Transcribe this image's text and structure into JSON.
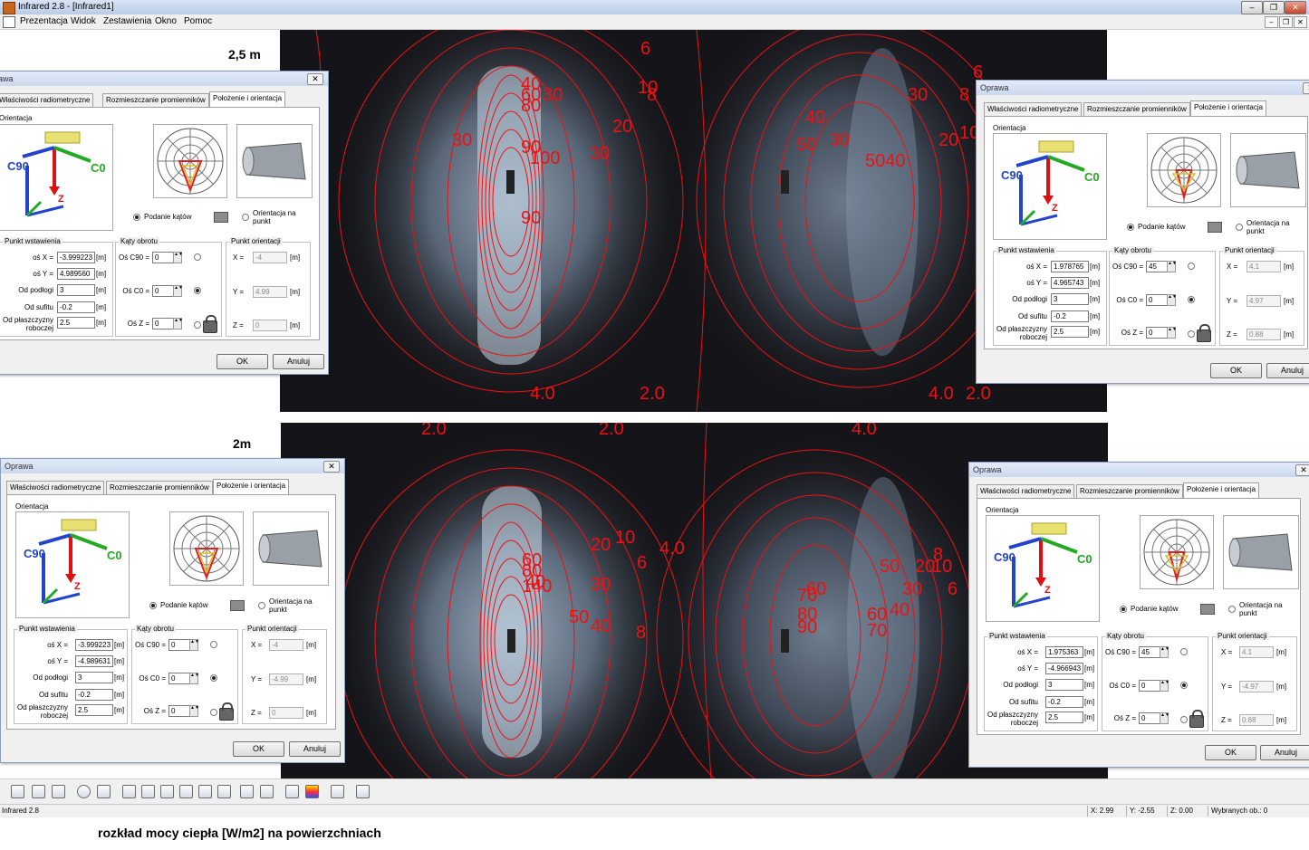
{
  "window": {
    "title": "Infrared 2.8 - [Infrared1]",
    "min_glyph": "–",
    "max_glyph": "❐",
    "close_glyph": "✕"
  },
  "menu": [
    "Prezentacja",
    "Widok",
    "Zestawienia",
    "Okno",
    "Pomoc"
  ],
  "heights": {
    "top": "2,5 m",
    "bottom": "2m"
  },
  "heatmap_top": {
    "labels": [
      "6",
      "6",
      "40",
      "60",
      "80",
      "30",
      "10",
      "8",
      "20",
      "30",
      "90",
      "100",
      "30",
      "90",
      "40",
      "50",
      "30",
      "30",
      "8",
      "20",
      "10",
      "5040",
      "4.0",
      "2.0",
      "4.0",
      "2.0"
    ]
  },
  "heatmap_bottom": {
    "labels": [
      "2.0",
      "2.0",
      "4.0",
      "20",
      "10",
      "4.0",
      "6",
      "60",
      "80",
      "40",
      "140",
      "30",
      "50",
      "40",
      "8",
      "50",
      "20",
      "10",
      "6",
      "8",
      "60",
      "70",
      "80",
      "90",
      "60",
      "40",
      "30",
      "70"
    ]
  },
  "dialogs": [
    {
      "title": "Oprawa",
      "tabs": [
        "Właściwości radiometryczne",
        "Rozmieszczanie promienników",
        "Położenie i orientacja"
      ],
      "orientation_title": "Orientacja",
      "axis_labels": {
        "c90": "C90",
        "c0": "C0",
        "z": "Z"
      },
      "radio_angles": "Podanie kątów",
      "radio_point": "Orientacja na punkt",
      "insert": {
        "title": "Punkt wstawienia",
        "x_label": "oś X =",
        "x": "-3.999223",
        "y_label": "oś Y =",
        "y": "4.989560",
        "floor_label": "Od podłogi",
        "floor": "3",
        "ceiling_label": "Od sufitu",
        "ceiling": "-0.2",
        "plane_label": "Od płaszczyzny roboczej",
        "plane": "2.5",
        "unit": "[m]"
      },
      "rotation": {
        "title": "Kąty obrotu",
        "c90_label": "Oś C90 =",
        "c90": "0",
        "c0_label": "Oś C0 =",
        "c0": "0",
        "z_label": "Oś Z =",
        "z": "0"
      },
      "orient_point": {
        "title": "Punkt orientacji",
        "x_label": "X =",
        "x": "-4",
        "y_label": "Y =",
        "y": "4.99",
        "z_label": "Z =",
        "z": "0",
        "unit": "[m]"
      },
      "ok": "OK",
      "cancel": "Anuluj"
    },
    {
      "title": "Oprawa",
      "tabs": [
        "Właściwości radiometryczne",
        "Rozmieszczanie promienników",
        "Położenie i orientacja"
      ],
      "orientation_title": "Orientacja",
      "axis_labels": {
        "c90": "C90",
        "c0": "C0",
        "z": "Z"
      },
      "radio_angles": "Podanie kątów",
      "radio_point": "Orientacja na punkt",
      "insert": {
        "title": "Punkt wstawienia",
        "x_label": "oś X =",
        "x": "1.978765",
        "y_label": "oś Y =",
        "y": "4.965743",
        "floor_label": "Od podłogi",
        "floor": "3",
        "ceiling_label": "Od sufitu",
        "ceiling": "-0.2",
        "plane_label": "Od płaszczyzny roboczej",
        "plane": "2.5",
        "unit": "[m]"
      },
      "rotation": {
        "title": "Kąty obrotu",
        "c90_label": "Oś C90 =",
        "c90": "45",
        "c0_label": "Oś C0 =",
        "c0": "0",
        "z_label": "Oś Z =",
        "z": "0"
      },
      "orient_point": {
        "title": "Punkt orientacji",
        "x_label": "X =",
        "x": "4.1",
        "y_label": "Y =",
        "y": "4.97",
        "z_label": "Z =",
        "z": "0.88",
        "unit": "[m]"
      },
      "ok": "OK",
      "cancel": "Anuluj"
    },
    {
      "title": "Oprawa",
      "tabs": [
        "Właściwości radiometryczne",
        "Rozmieszczanie promienników",
        "Położenie i orientacja"
      ],
      "orientation_title": "Orientacja",
      "axis_labels": {
        "c90": "C90",
        "c0": "C0",
        "z": "Z"
      },
      "radio_angles": "Podanie kątów",
      "radio_point": "Orientacja na punkt",
      "insert": {
        "title": "Punkt wstawienia",
        "x_label": "oś X =",
        "x": "-3.999223",
        "y_label": "oś Y =",
        "y": "-4.989631",
        "floor_label": "Od podłogi",
        "floor": "3",
        "ceiling_label": "Od sufitu",
        "ceiling": "-0.2",
        "plane_label": "Od płaszczyzny roboczej",
        "plane": "2.5",
        "unit": "[m]"
      },
      "rotation": {
        "title": "Kąty obrotu",
        "c90_label": "Oś C90 =",
        "c90": "0",
        "c0_label": "Oś C0 =",
        "c0": "0",
        "z_label": "Oś Z =",
        "z": "0"
      },
      "orient_point": {
        "title": "Punkt orientacji",
        "x_label": "X =",
        "x": "-4",
        "y_label": "Y =",
        "y": "-4.99",
        "z_label": "Z =",
        "z": "0",
        "unit": "[m]"
      },
      "ok": "OK",
      "cancel": "Anuluj"
    },
    {
      "title": "Oprawa",
      "tabs": [
        "Właściwości radiometryczne",
        "Rozmieszczanie promienników",
        "Położenie i orientacja"
      ],
      "orientation_title": "Orientacja",
      "axis_labels": {
        "c90": "C90",
        "c0": "C0",
        "z": "Z"
      },
      "radio_angles": "Podanie kątów",
      "radio_point": "Orientacja na punkt",
      "insert": {
        "title": "Punkt wstawienia",
        "x_label": "oś X =",
        "x": "1.975363",
        "y_label": "oś Y =",
        "y": "-4.966943",
        "floor_label": "Od podłogi",
        "floor": "3",
        "ceiling_label": "Od sufitu",
        "ceiling": "-0.2",
        "plane_label": "Od płaszczyzny roboczej",
        "plane": "2.5",
        "unit": "[m]"
      },
      "rotation": {
        "title": "Kąty obrotu",
        "c90_label": "Oś C90 =",
        "c90": "45",
        "c0_label": "Oś C0 =",
        "c0": "0",
        "z_label": "Oś Z =",
        "z": "0"
      },
      "orient_point": {
        "title": "Punkt orientacji",
        "x_label": "X =",
        "x": "4.1",
        "y_label": "Y =",
        "y": "-4.97",
        "z_label": "Z =",
        "z": "0.88",
        "unit": "[m]"
      },
      "ok": "OK",
      "cancel": "Anuluj"
    }
  ],
  "toolbar_icons": [
    "open-icon",
    "save-icon",
    "print-icon",
    "target-icon",
    "view-icon",
    "cube-icon",
    "cube-icon",
    "cube-icon",
    "cube-icon",
    "cube-icon",
    "cube-icon",
    "cube-icon",
    "cube-icon",
    "view-3d-icon",
    "heatmap-icon",
    "box-icon",
    "report-icon"
  ],
  "status": {
    "app": "Infrared 2.8",
    "x": "X: 2.99",
    "y": "Y: -2.55",
    "z": "Z: 0.00",
    "selected": "Wybranych ob.: 0"
  },
  "caption": "rozkład mocy ciepła [W/m2]  na powierzchniach",
  "colors": {
    "contour": "#ee1111",
    "background_dark": "#151519",
    "glow": "#9fb4cc"
  }
}
